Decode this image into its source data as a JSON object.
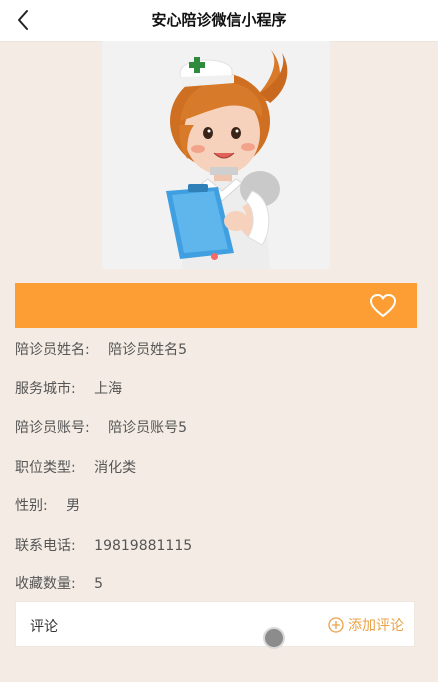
{
  "header": {
    "title": "安心陪诊微信小程序",
    "back_icon": "back-arrow-icon"
  },
  "hero": {
    "image": "nurse-illustration",
    "carousel_dots": 1
  },
  "action_bar": {
    "color": "#fd9e34",
    "favorite_icon": "heart-outline-icon"
  },
  "fields": [
    {
      "label": "陪诊员姓名:",
      "value": "陪诊员姓名5"
    },
    {
      "label": "服务城市:",
      "value": "上海"
    },
    {
      "label": "陪诊员账号:",
      "value": "陪诊员账号5"
    },
    {
      "label": "职位类型:",
      "value": "消化类"
    },
    {
      "label": "性别:",
      "value": "男"
    },
    {
      "label": "联系电话:",
      "value": "19819881115"
    },
    {
      "label": "收藏数量:",
      "value": "5"
    }
  ],
  "comments": {
    "label": "评论",
    "add_label": "添加评论",
    "add_icon": "plus-circle-icon",
    "accent": "#e8a24a"
  }
}
